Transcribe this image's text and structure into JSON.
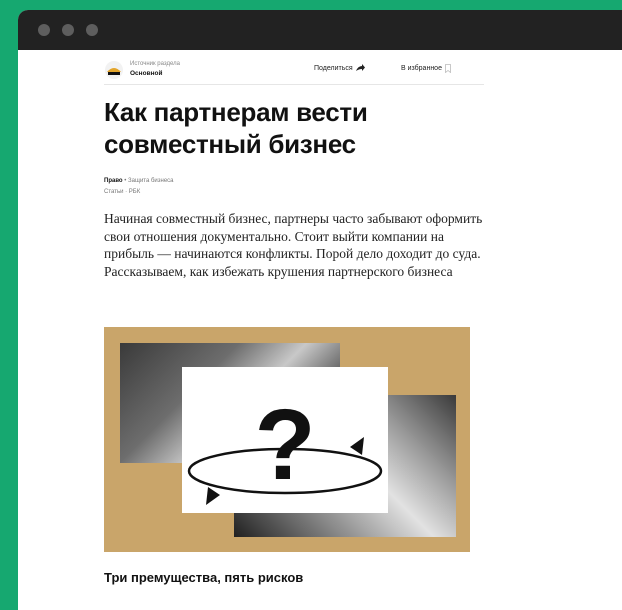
{
  "window": {
    "dots": [
      "close",
      "minimize",
      "maximize"
    ]
  },
  "header": {
    "section_caption": "Источник раздела",
    "section_name": "Основной",
    "share_label": "Поделиться",
    "share_icon": "share-arrow-icon",
    "favorite_label": "В избранное",
    "favorite_icon": "bookmark-icon"
  },
  "article": {
    "title": "Как партнерам вести совместный бизнес",
    "tag_primary": "Право",
    "tag_separator": "•",
    "tag_secondary": "Защита бизнеса",
    "meta_line2": "Статьи · РБК",
    "lead": "Начиная совместный бизнес, партнеры часто забывают оформить свои отношения документально. Стоит выйти компании на прибыль — начинаются конфликты. Порой дело доходит до суда. Рассказываем, как избежать крушения партнерского бизнеса",
    "hero_symbol": "?",
    "subheading": "Три премущества, пять рисков"
  },
  "colors": {
    "page_background": "#16a870",
    "titlebar": "#222222",
    "hero_background": "#c9a56a",
    "accent_logo": "#e3a52b"
  }
}
